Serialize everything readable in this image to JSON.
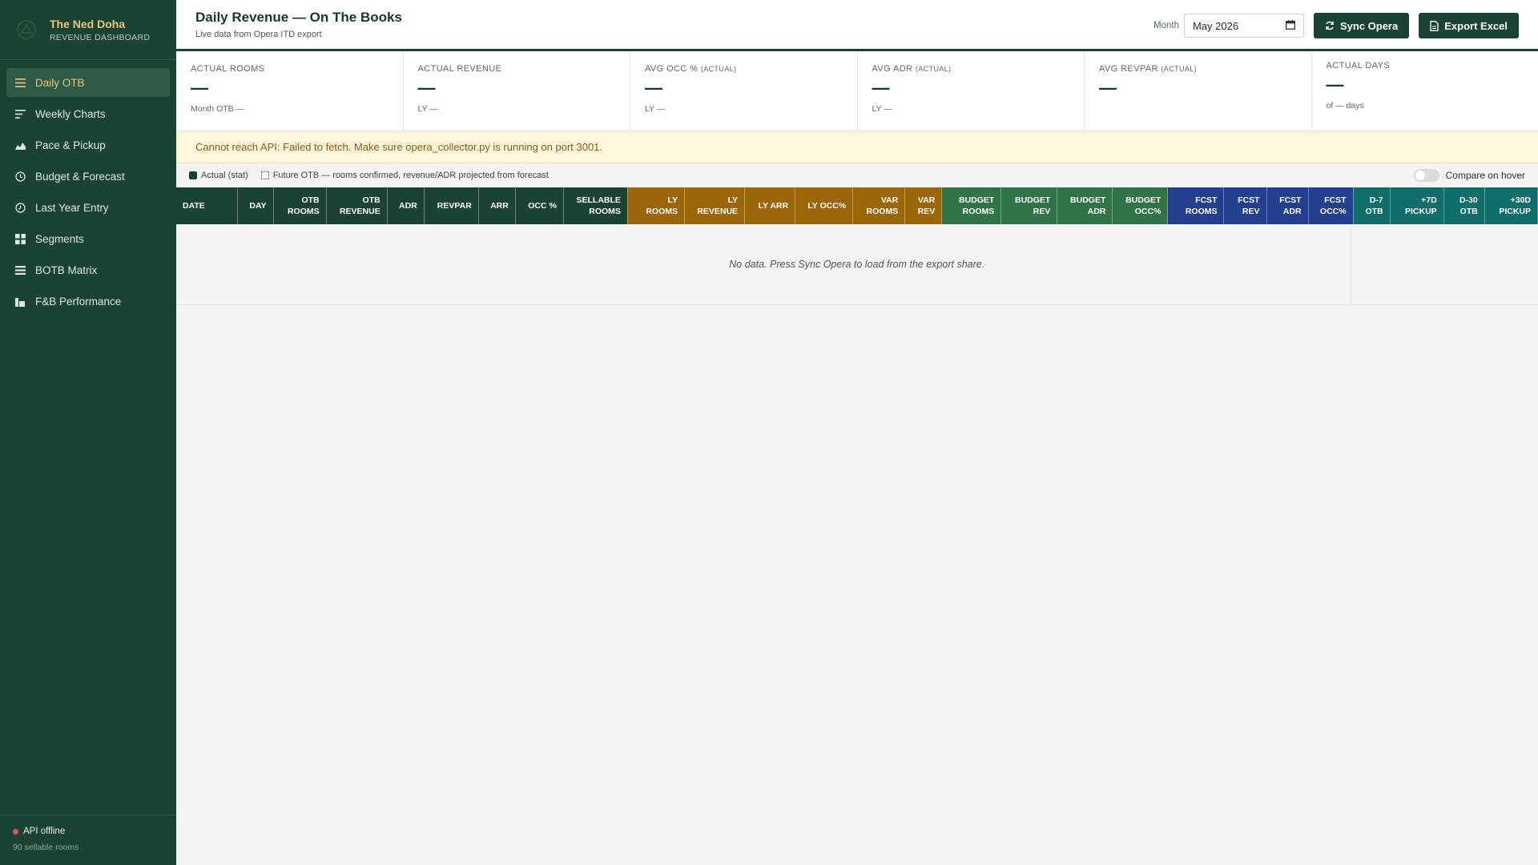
{
  "brand": {
    "name": "The Ned Doha",
    "subtitle": "REVENUE DASHBOARD"
  },
  "nav": [
    {
      "label": "Daily OTB",
      "icon": "menu-lines-icon",
      "active": true
    },
    {
      "label": "Weekly Charts",
      "icon": "list-sort-icon"
    },
    {
      "label": "Pace & Pickup",
      "icon": "area-chart-icon"
    },
    {
      "label": "Budget & Forecast",
      "icon": "clock-icon"
    },
    {
      "label": "Last Year Entry",
      "icon": "history-icon"
    },
    {
      "label": "Segments",
      "icon": "grid-icon"
    },
    {
      "label": "BOTB Matrix",
      "icon": "table-rows-icon"
    },
    {
      "label": "F&B Performance",
      "icon": "bar-chart-icon"
    }
  ],
  "footer": {
    "api_status": "API offline",
    "rooms_note": "90 sellable rooms"
  },
  "header": {
    "title": "Daily Revenue — On The Books",
    "subtitle": "Live data from Opera ITD export",
    "month_label": "Month",
    "month_value": "May 2026",
    "sync_label": "Sync Opera",
    "export_label": "Export Excel"
  },
  "kpis": [
    {
      "label": "ACTUAL ROOMS",
      "qual": "",
      "value": "—",
      "sub": "Month OTB —"
    },
    {
      "label": "ACTUAL REVENUE",
      "qual": "",
      "value": "—",
      "sub": "LY —"
    },
    {
      "label": "AVG OCC %",
      "qual": "(ACTUAL)",
      "value": "—",
      "sub": "LY —"
    },
    {
      "label": "AVG ADR",
      "qual": "(ACTUAL)",
      "value": "—",
      "sub": "LY —"
    },
    {
      "label": "AVG REVPAR",
      "qual": "(ACTUAL)",
      "value": "—",
      "sub": ""
    },
    {
      "label": "ACTUAL DAYS",
      "qual": "",
      "value": "—",
      "sub": "of — days"
    }
  ],
  "alert": "Cannot reach API: Failed to fetch. Make sure opera_collector.py is running on port 3001.",
  "legend": {
    "actual": "Actual (stat)",
    "future": "Future OTB — rooms confirmed, revenue/ADR projected from forecast",
    "compare": "Compare on hover"
  },
  "table": {
    "columns": [
      {
        "l1": "DATE",
        "l2": "",
        "group": "otb",
        "align": "left"
      },
      {
        "l1": "DAY",
        "l2": "",
        "group": "otb"
      },
      {
        "l1": "OTB",
        "l2": "ROOMS",
        "group": "otb"
      },
      {
        "l1": "OTB",
        "l2": "REVENUE",
        "group": "otb"
      },
      {
        "l1": "ADR",
        "l2": "",
        "group": "otb"
      },
      {
        "l1": "REVPAR",
        "l2": "",
        "group": "otb"
      },
      {
        "l1": "ARR",
        "l2": "",
        "group": "otb"
      },
      {
        "l1": "OCC %",
        "l2": "",
        "group": "otb"
      },
      {
        "l1": "SELLABLE",
        "l2": "ROOMS",
        "group": "otb"
      },
      {
        "l1": "LY",
        "l2": "ROOMS",
        "group": "ly"
      },
      {
        "l1": "LY",
        "l2": "REVENUE",
        "group": "ly"
      },
      {
        "l1": "LY ARR",
        "l2": "",
        "group": "ly"
      },
      {
        "l1": "LY OCC%",
        "l2": "",
        "group": "ly"
      },
      {
        "l1": "VAR",
        "l2": "ROOMS",
        "group": "ly"
      },
      {
        "l1": "VAR",
        "l2": "REV",
        "group": "ly"
      },
      {
        "l1": "BUDGET",
        "l2": "ROOMS",
        "group": "bud"
      },
      {
        "l1": "BUDGET",
        "l2": "REV",
        "group": "bud"
      },
      {
        "l1": "BUDGET",
        "l2": "ADR",
        "group": "bud"
      },
      {
        "l1": "BUDGET",
        "l2": "OCC%",
        "group": "bud"
      },
      {
        "l1": "FCST",
        "l2": "ROOMS",
        "group": "fcst"
      },
      {
        "l1": "FCST",
        "l2": "REV",
        "group": "fcst"
      },
      {
        "l1": "FCST",
        "l2": "ADR",
        "group": "fcst"
      },
      {
        "l1": "FCST",
        "l2": "OCC%",
        "group": "fcst"
      },
      {
        "l1": "D-7",
        "l2": "OTB",
        "group": "pick"
      },
      {
        "l1": "+7D",
        "l2": "PICKUP",
        "group": "pick"
      },
      {
        "l1": "D-30",
        "l2": "OTB",
        "group": "pick"
      },
      {
        "l1": "+30D",
        "l2": "PICKUP",
        "group": "pick"
      }
    ],
    "empty_message": "No data. Press Sync Opera to load from the export share."
  },
  "colors": {
    "sidebar": "#1b4332",
    "accent_gold": "#e8c77a",
    "group_otb": "#1b4332",
    "group_ly": "#9c6508",
    "group_budget": "#2f7347",
    "group_forecast": "#253f8f",
    "group_pickup": "#0f6e6c",
    "alert_bg": "#fdf6dc",
    "offline_dot": "#e05252"
  }
}
